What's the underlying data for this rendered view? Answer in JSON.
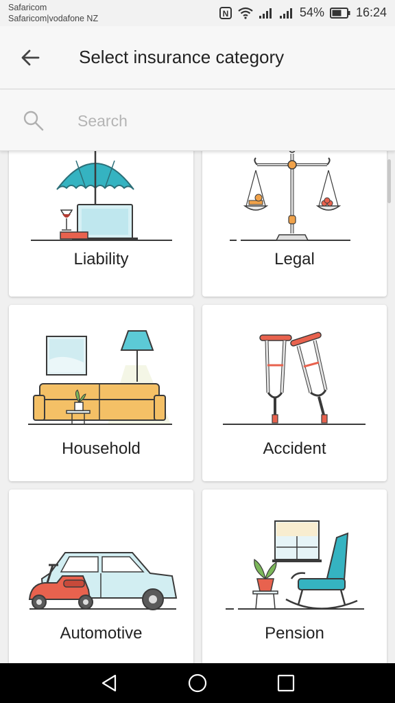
{
  "status": {
    "carrier_line1": "Safaricom",
    "carrier_line2": "Safaricom|vodafone NZ",
    "battery": "54%",
    "time": "16:24",
    "icons": [
      "nfc-icon",
      "wifi-icon",
      "signal-icon",
      "signal-icon",
      "battery-icon"
    ]
  },
  "header": {
    "title": "Select insurance category",
    "back_icon": "arrow-left-icon"
  },
  "search": {
    "placeholder": "Search",
    "icon": "search-icon"
  },
  "categories": [
    {
      "label": "Liability",
      "icon": "umbrella-laptop-illustration"
    },
    {
      "label": "Legal",
      "icon": "scales-illustration"
    },
    {
      "label": "Household",
      "icon": "sofa-lamp-illustration"
    },
    {
      "label": "Accident",
      "icon": "crutches-illustration"
    },
    {
      "label": "Automotive",
      "icon": "car-scooter-illustration"
    },
    {
      "label": "Pension",
      "icon": "rocking-chair-illustration"
    }
  ],
  "navigation": {
    "back": "triangle-back-icon",
    "home": "circle-home-icon",
    "recents": "square-recents-icon"
  },
  "colors": {
    "accent_teal": "#35b3c1",
    "accent_orange": "#f0a24a",
    "accent_red": "#e8624e",
    "outline": "#3a3a3a"
  }
}
